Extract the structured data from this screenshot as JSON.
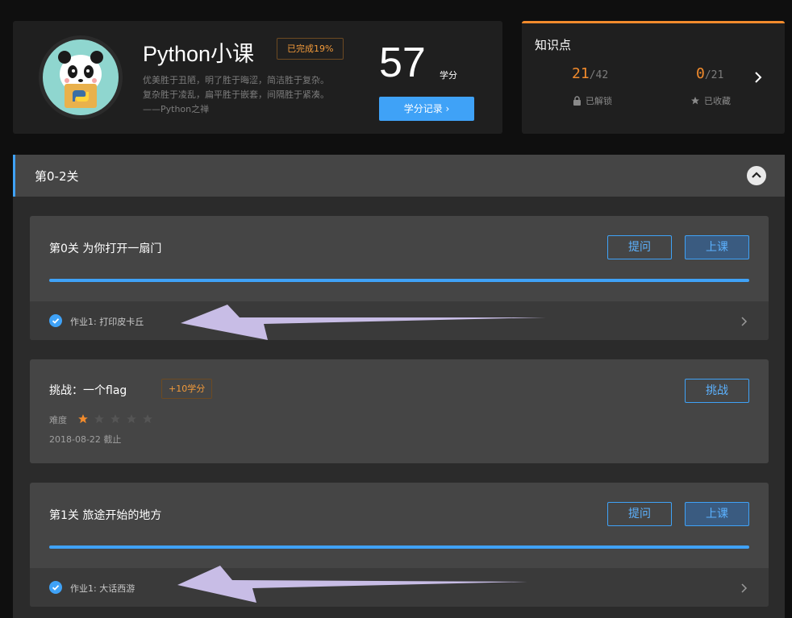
{
  "profile": {
    "course_title": "Python小课",
    "progress_badge": "已完成19%",
    "motto": [
      "优美胜于丑陋，明了胜于晦涩，简洁胜于复杂。",
      "复杂胜于凌乱，扁平胜于嵌套，间隔胜于紧凑。",
      "——Python之禅"
    ],
    "score": "57",
    "score_unit": "学分",
    "score_button": "学分记录 ›"
  },
  "knowledge": {
    "title": "知识点",
    "unlocked": {
      "value": "21",
      "total": "/42",
      "label": "已解锁",
      "icon": "lock-icon"
    },
    "favorited": {
      "value": "0",
      "total": "/21",
      "label": "已收藏",
      "icon": "star-icon"
    }
  },
  "section": {
    "title": "第0-2关",
    "lessons": [
      {
        "title": "第0关  为你打开一扇门",
        "ask_button": "提问",
        "class_button": "上课",
        "progress": 1.0,
        "homework": "作业1: 打印皮卡丘"
      },
      {
        "title": "第1关  旅途开始的地方",
        "ask_button": "提问",
        "class_button": "上课",
        "progress": 1.0,
        "homework": "作业1: 大话西游"
      }
    ],
    "challenge": {
      "title": "挑战：一个flag",
      "bonus": "+10学分",
      "button": "挑战",
      "difficulty_label": "难度",
      "difficulty": 1,
      "difficulty_max": 5,
      "deadline": "2018-08-22 截止"
    }
  },
  "colors": {
    "accent": "#3fa2f7",
    "orange": "#f28b2c",
    "annotation_arrow": "#c8bde6"
  }
}
